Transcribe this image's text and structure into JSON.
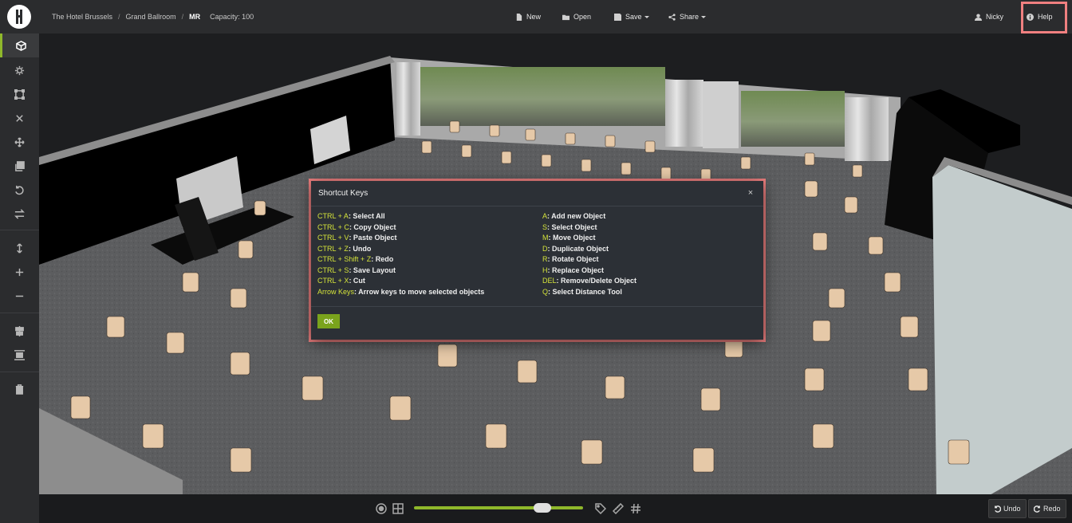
{
  "topbar": {
    "breadcrumb": [
      "The Hotel Brussels",
      "Grand Ballroom",
      "MR"
    ],
    "capacity": "Capacity: 100",
    "menu": {
      "new": "New",
      "open": "Open",
      "save": "Save",
      "share": "Share"
    },
    "user": "Nicky",
    "help": "Help"
  },
  "sidebar": {
    "tools": [
      "cube-icon",
      "gear-icon",
      "select-frame-icon",
      "close-icon",
      "move-icon",
      "duplicate-icon",
      "rotate-icon",
      "swap-icon",
      "height-icon",
      "plus-icon",
      "minus-icon",
      "align-center-icon",
      "distribute-icon",
      "trash-icon"
    ]
  },
  "modal": {
    "title": "Shortcut Keys",
    "close": "×",
    "ok": "OK",
    "left_shortcuts": [
      {
        "key": "CTRL + A",
        "desc": ": Select All"
      },
      {
        "key": "CTRL + C",
        "desc": ": Copy Object"
      },
      {
        "key": "CTRL + V",
        "desc": ": Paste Object"
      },
      {
        "key": "CTRL + Z",
        "desc": ": Undo"
      },
      {
        "key": "CTRL + Shift + Z",
        "desc": ": Redo"
      },
      {
        "key": "CTRL + S",
        "desc": ": Save Layout"
      },
      {
        "key": "CTRL + X",
        "desc": ": Cut"
      },
      {
        "key": "Arrow Keys",
        "desc": ": Arrow keys to move selected objects"
      }
    ],
    "right_shortcuts": [
      {
        "key": "A",
        "desc": ": Add new Object"
      },
      {
        "key": "S",
        "desc": ": Select Object"
      },
      {
        "key": "M",
        "desc": ": Move Object"
      },
      {
        "key": "D",
        "desc": ": Duplicate Object"
      },
      {
        "key": "R",
        "desc": ": Rotate Object"
      },
      {
        "key": "H",
        "desc": ": Replace Object"
      },
      {
        "key": "DEL",
        "desc": ": Remove/Delete Object"
      },
      {
        "key": "Q",
        "desc": ": Select Distance Tool"
      }
    ]
  },
  "bottombar": {
    "undo": "Undo",
    "redo": "Redo",
    "zoom_level": 0.76
  },
  "colors": {
    "accent": "#8fb82b",
    "key_text": "#d4e33a",
    "highlight": "#f08080"
  }
}
